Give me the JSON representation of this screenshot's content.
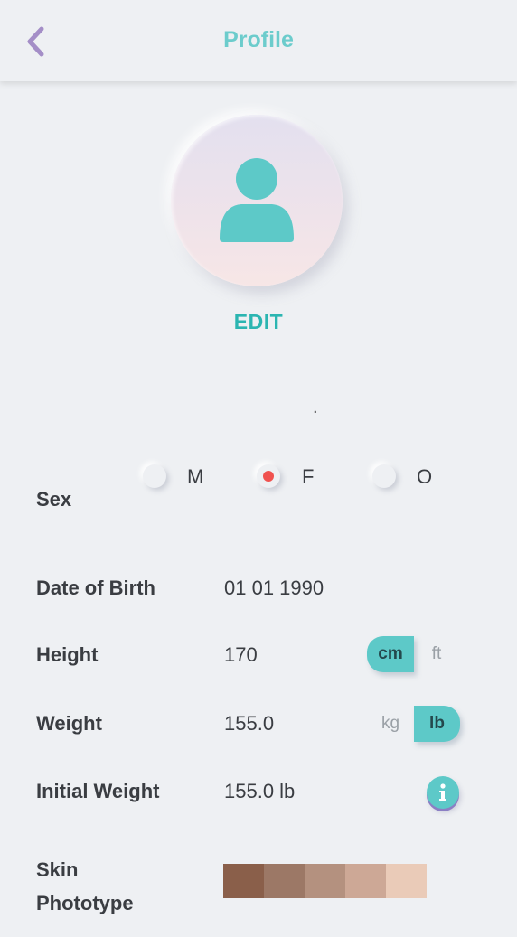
{
  "header": {
    "title": "Profile",
    "back_icon": "chevron-left-icon"
  },
  "avatar": {
    "icon": "user-icon",
    "edit_label": "EDIT"
  },
  "name_placeholder": ".",
  "sex": {
    "label": "Sex",
    "options": [
      {
        "label": "M",
        "selected": false
      },
      {
        "label": "F",
        "selected": true
      },
      {
        "label": "O",
        "selected": false
      }
    ]
  },
  "dob": {
    "label": "Date of Birth",
    "value": "01 01 1990"
  },
  "height": {
    "label": "Height",
    "value": "170",
    "units": [
      "cm",
      "ft"
    ],
    "selected_unit": "cm"
  },
  "weight": {
    "label": "Weight",
    "value": "155.0",
    "units": [
      "kg",
      "lb"
    ],
    "selected_unit": "lb"
  },
  "initial_weight": {
    "label": "Initial Weight",
    "value": "155.0 lb",
    "info_icon": "info-icon"
  },
  "skin": {
    "label_line1": "Skin",
    "label_line2": "Phototype",
    "swatches": [
      "#8a5f4a",
      "#9c7866",
      "#b4917f",
      "#cda896",
      "#eacbb8"
    ]
  },
  "colors": {
    "accent": "#5dc9c8",
    "title": "#6ccccc",
    "edit": "#2bb5b1",
    "selected_radio": "#f0524f",
    "back": "#a48ec7"
  }
}
